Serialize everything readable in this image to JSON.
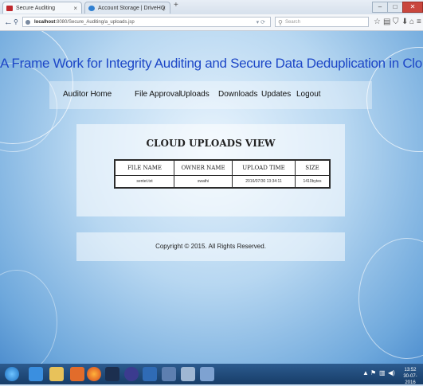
{
  "browser": {
    "tabs": [
      {
        "title": "Secure Auditing"
      },
      {
        "title": "Account Storage | DriveHQ"
      }
    ],
    "new_tab": "+",
    "url": {
      "host": "localhost",
      "path": ":8080/Secure_Auditing/a_uploads.jsp"
    },
    "search_placeholder": "Search",
    "window_controls": {
      "minimize": "–",
      "maximize": "□",
      "close": "✕"
    },
    "colors": {
      "tab_secure": "#c0282d",
      "tab_drive": "#2f7fd1"
    }
  },
  "site": {
    "title": "A Frame Work for Integrity Auditing and Secure Data Deduplication in Cloud Storage",
    "title_color": "#1d47c7"
  },
  "menu": {
    "items": [
      {
        "label": "Auditor Home"
      },
      {
        "label": "File Approval"
      },
      {
        "label": "Uploads"
      },
      {
        "label": "Downloads"
      },
      {
        "label": "Updates"
      },
      {
        "label": "Logout"
      }
    ]
  },
  "panel": {
    "title": "CLOUD UPLOADS VIEW",
    "table": {
      "headers": [
        "FILE NAME",
        "OWNER NAME",
        "UPLOAD TIME",
        "SIZE"
      ],
      "rows": [
        [
          "sentet.txt",
          "swathi",
          "2016/07/30 13:34:11",
          "1410bytes"
        ]
      ]
    }
  },
  "footer": {
    "copyright": "Copyright © 2015. All Rights Reserved."
  },
  "taskbar": {
    "clock_time": "13:52",
    "clock_date": "30-07-2016"
  }
}
